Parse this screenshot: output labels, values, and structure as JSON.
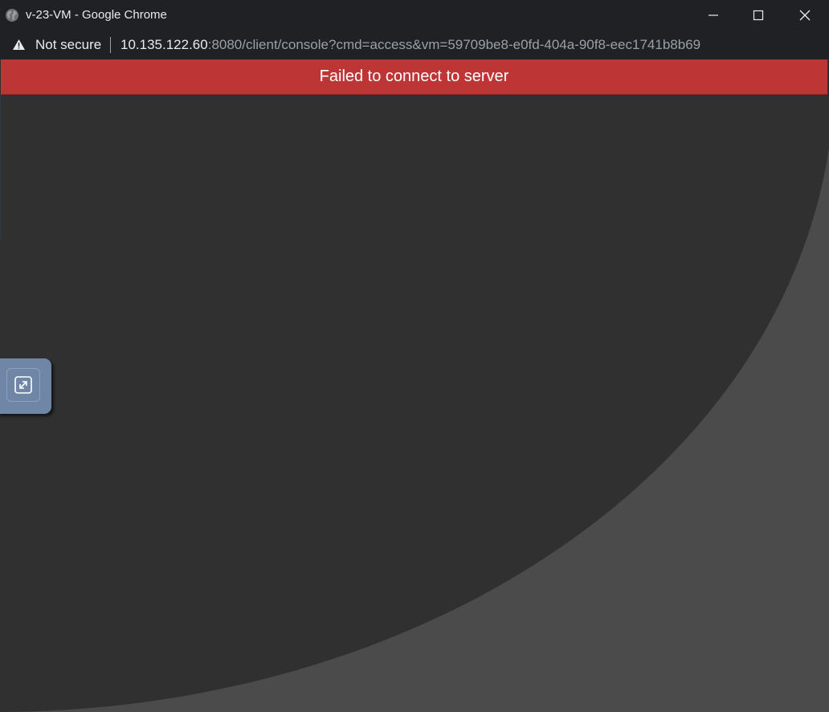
{
  "window": {
    "title": "v-23-VM - Google Chrome",
    "icon": "globe-icon",
    "controls": [
      "minimize-icon",
      "maximize-icon",
      "close-icon"
    ]
  },
  "address_bar": {
    "security_label": "Not secure",
    "security_icon": "warning-icon",
    "url_host": "10.135.122.60",
    "url_rest": ":8080/client/console?cmd=access&vm=59709be8-e0fd-404a-90f8-eec1741b8b69"
  },
  "console": {
    "error_message": "Failed to connect to server",
    "fullscreen_icon": "expand-icon"
  },
  "colors": {
    "chrome_bg": "#202124",
    "error_banner": "#bd3535",
    "console_dark": "#303030",
    "console_light": "#4b4b4b",
    "panel": "#6f86a6"
  }
}
